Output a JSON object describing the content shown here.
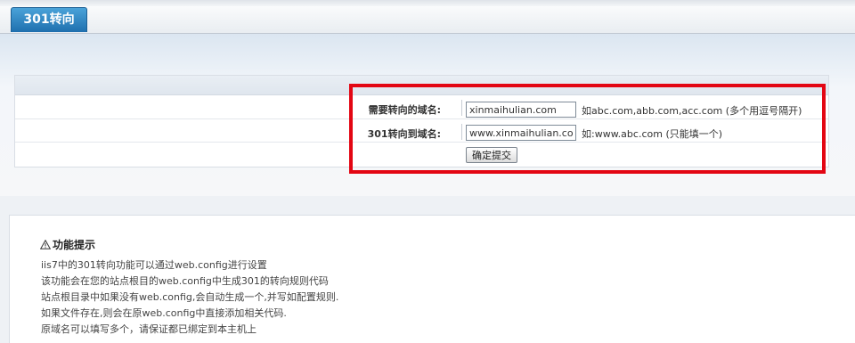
{
  "tab": {
    "label": "301转向"
  },
  "form": {
    "source_label": "需要转向的域名:",
    "source_value": "xinmaihulian.com",
    "source_hint": "如abc.com,abb.com,acc.com (多个用逗号隔开)",
    "target_label": "301转向到域名:",
    "target_value": "www.xinmaihulian.com",
    "target_hint": "如:www.abc.com (只能填一个)",
    "submit_label": "确定提交"
  },
  "tips": {
    "icon": "warning-triangle-icon",
    "title": "功能提示",
    "lines": [
      "iis7中的301转向功能可以通过web.config进行设置",
      "该功能会在您的站点根目的web.config中生成301的转向规则代码",
      "站点根目录中如果没有web.config,会自动生成一个,并写如配置规则.",
      "如果文件存在,则会在原web.config中直接添加相关代码.",
      "原域名可以填写多个，请保证都已绑定到本主机上"
    ]
  },
  "colors": {
    "accent": "#1f6fae",
    "highlight": "#e30613"
  }
}
